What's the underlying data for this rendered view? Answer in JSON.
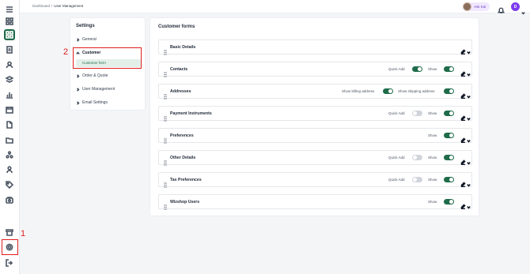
{
  "breadcrumb": {
    "items": [
      "Dashboard",
      "User Management"
    ],
    "separator": "/"
  },
  "header": {
    "user_name": "Ask Kai",
    "avatar_initial": "D"
  },
  "sidebar_icons": [
    "menu-icon",
    "dashboard-icon",
    "grid-icon",
    "document-icon",
    "user-icon",
    "layers-icon",
    "chart-icon",
    "calendar-icon",
    "file-icon",
    "folder-icon",
    "network-icon",
    "person-icon",
    "tag-icon",
    "package-icon",
    "store-icon",
    "settings-icon",
    "logout-icon"
  ],
  "settings": {
    "title": "Settings",
    "items": [
      {
        "label": "General",
        "expanded": false
      },
      {
        "label": "Customer",
        "expanded": true
      },
      {
        "label": "Order & Quote",
        "expanded": false
      },
      {
        "label": "User Management",
        "expanded": false
      },
      {
        "label": "Email Settings",
        "expanded": false
      }
    ],
    "subitem": "Customer form"
  },
  "annotations": {
    "one": "1",
    "two": "2"
  },
  "main": {
    "title": "Customer forms",
    "rows": [
      {
        "label": "Basic Details",
        "options": []
      },
      {
        "label": "Contacts",
        "options": [
          {
            "label": "Quick Add",
            "on": true
          },
          {
            "label": "Show",
            "on": true
          }
        ]
      },
      {
        "label": "Addresses",
        "options": [
          {
            "label": "Show billing address",
            "on": true
          },
          {
            "label": "Show shipping address",
            "on": true
          }
        ]
      },
      {
        "label": "Payment Instruments",
        "options": [
          {
            "label": "Quick Add",
            "on": false
          },
          {
            "label": "Show",
            "on": true
          }
        ]
      },
      {
        "label": "Preferences",
        "options": [
          {
            "label": "Show",
            "on": true
          }
        ]
      },
      {
        "label": "Other Details",
        "options": [
          {
            "label": "Quick Add",
            "on": false
          },
          {
            "label": "Show",
            "on": true
          }
        ]
      },
      {
        "label": "Tax Preferences",
        "options": [
          {
            "label": "Quick Add",
            "on": false
          },
          {
            "label": "Show",
            "on": true
          }
        ]
      },
      {
        "label": "Wizshop Users",
        "options": [
          {
            "label": "Show",
            "on": true
          }
        ]
      }
    ]
  },
  "colors": {
    "accent": "#1f6b4a",
    "annotation": "#e11d1d",
    "toggle_off": "#d1d5db"
  }
}
